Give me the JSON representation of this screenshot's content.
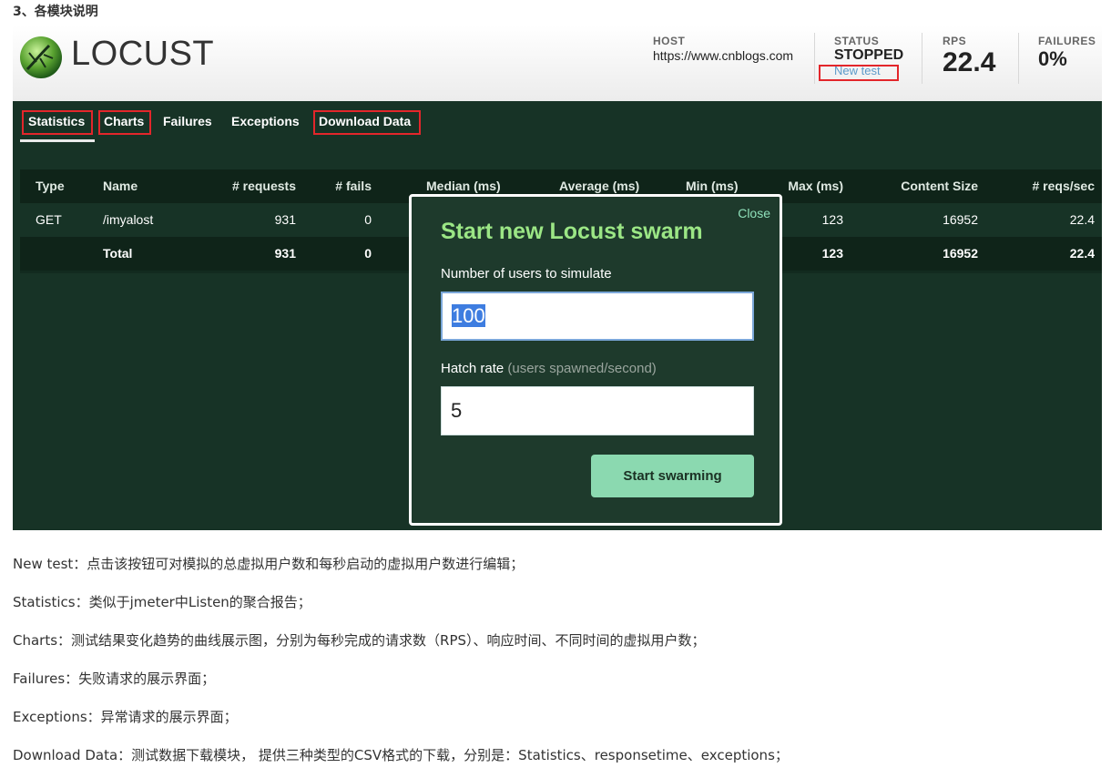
{
  "section_heading": "3、各模块说明",
  "header": {
    "logo_text": "LOCUST",
    "host_label": "HOST",
    "host_value": "https://www.cnblogs.com",
    "status_label": "STATUS",
    "status_value": "STOPPED",
    "new_test_label": "New test",
    "rps_label": "RPS",
    "rps_value": "22.4",
    "failures_label": "FAILURES",
    "failures_value": "0%"
  },
  "tabs": [
    {
      "label": "Statistics",
      "active": true
    },
    {
      "label": "Charts"
    },
    {
      "label": "Failures"
    },
    {
      "label": "Exceptions"
    },
    {
      "label": "Download Data"
    }
  ],
  "table": {
    "headers": [
      "Type",
      "Name",
      "# requests",
      "# fails",
      "Median (ms)",
      "Average (ms)",
      "Min (ms)",
      "Max (ms)",
      "Content Size",
      "# reqs/sec"
    ],
    "rows": [
      {
        "type": "GET",
        "name": "/imyalost",
        "requests": "931",
        "fails": "0",
        "max": "123",
        "content_size": "16952",
        "reqs_sec": "22.4"
      },
      {
        "type": "",
        "name": "Total",
        "requests": "931",
        "fails": "0",
        "max": "123",
        "content_size": "16952",
        "reqs_sec": "22.4"
      }
    ]
  },
  "modal": {
    "close_label": "Close",
    "title": "Start new Locust swarm",
    "users_label": "Number of users to simulate",
    "users_value": "100",
    "hatch_label": "Hatch rate",
    "hatch_hint": "(users spawned/second)",
    "hatch_value": "5",
    "start_button": "Start swarming"
  },
  "notes": [
    "New test：点击该按钮可对模拟的总虚拟用户数和每秒启动的虚拟用户数进行编辑；",
    "Statistics：类似于jmeter中Listen的聚合报告；",
    "Charts：测试结果变化趋势的曲线展示图，分别为每秒完成的请求数（RPS）、响应时间、不同时间的虚拟用户数；",
    "Failures：失败请求的展示界面；",
    "Exceptions：异常请求的展示界面；",
    "Download Data：测试数据下载模块， 提供三种类型的CSV格式的下载，分别是：Statistics、responsetime、exceptions；"
  ],
  "colors": {
    "app_background": "#173326",
    "highlight_box": "#e3262b",
    "modal_title": "#9be685",
    "start_button": "#8bd9b0",
    "new_test_link": "#5c9ac9"
  },
  "icons": {
    "logo": "locust-logo-icon"
  }
}
